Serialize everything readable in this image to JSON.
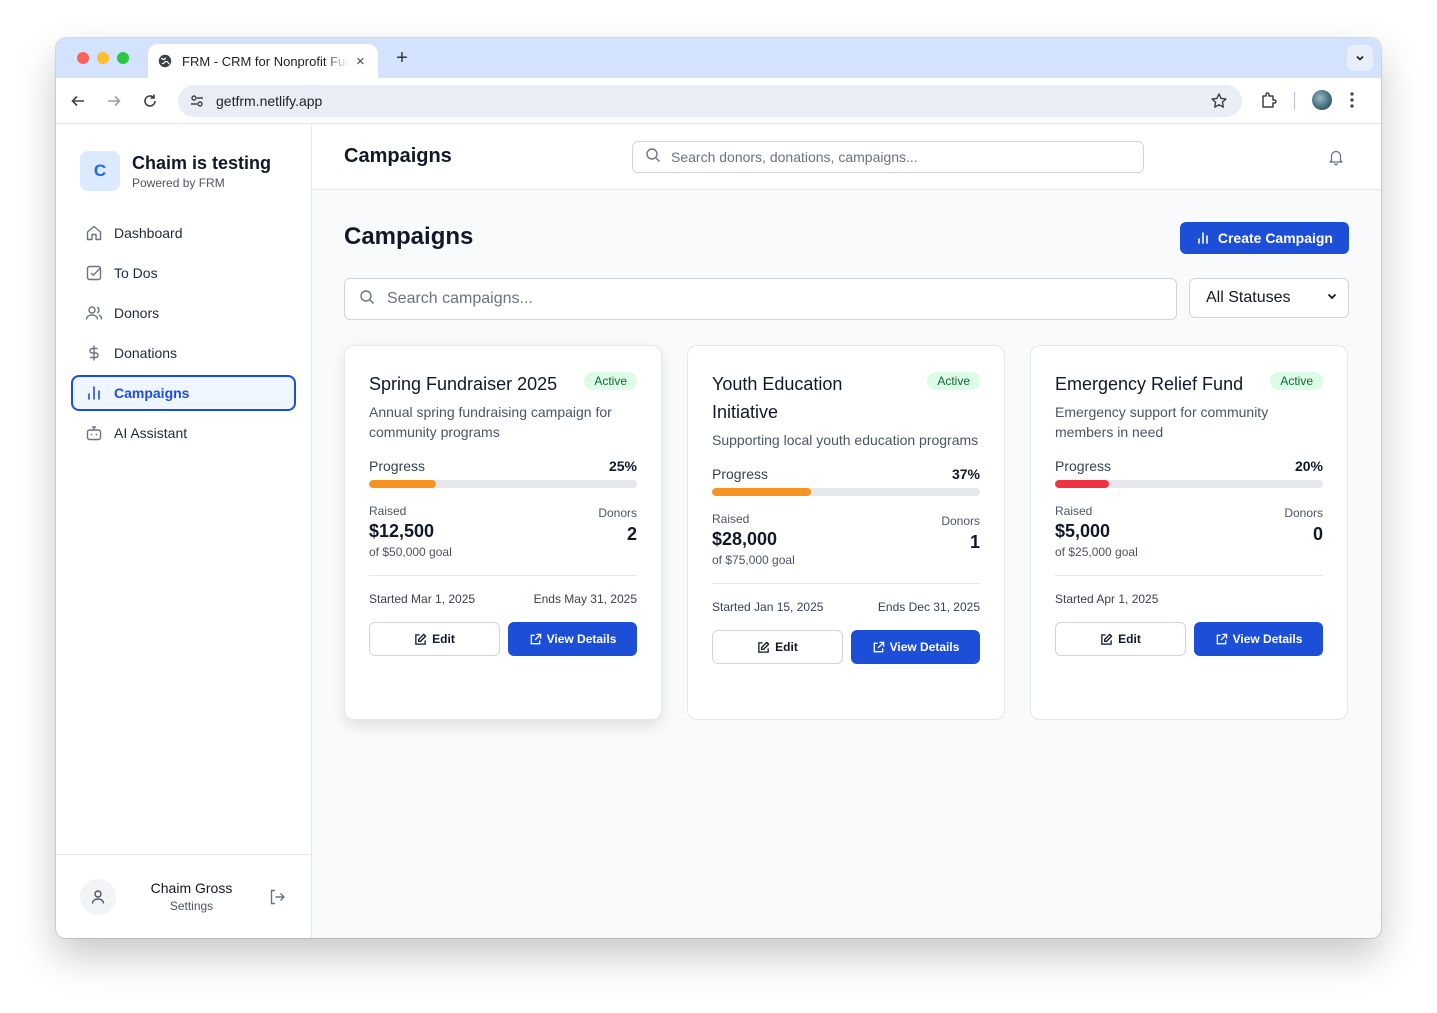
{
  "browser": {
    "tab_title": "FRM - CRM for Nonprofit Fundraising",
    "url": "getfrm.netlify.app"
  },
  "brand": {
    "logo_letter": "C",
    "name": "Chaim is testing",
    "subtitle": "Powered by FRM"
  },
  "sidebar": {
    "items": [
      {
        "label": "Dashboard",
        "icon": "home-icon"
      },
      {
        "label": "To Dos",
        "icon": "checkbox-icon"
      },
      {
        "label": "Donors",
        "icon": "users-icon"
      },
      {
        "label": "Donations",
        "icon": "dollar-icon"
      },
      {
        "label": "Campaigns",
        "icon": "bar-chart-icon",
        "active": true
      },
      {
        "label": "AI Assistant",
        "icon": "bot-icon"
      }
    ]
  },
  "user": {
    "name": "Chaim Gross",
    "settings_label": "Settings"
  },
  "header": {
    "title": "Campaigns",
    "search_placeholder": "Search donors, donations, campaigns..."
  },
  "page": {
    "title": "Campaigns",
    "create_label": "Create Campaign",
    "search_placeholder": "Search campaigns...",
    "status_filter": "All Statuses"
  },
  "labels": {
    "progress": "Progress",
    "raised": "Raised",
    "donors": "Donors",
    "edit": "Edit",
    "view_details": "View Details"
  },
  "campaigns": [
    {
      "title": "Spring Fundraiser 2025",
      "status": "Active",
      "description": "Annual spring fundraising campaign for community programs",
      "progress": 25,
      "progress_label": "25%",
      "progress_color": "#f7931e",
      "raised": "$12,500",
      "goal": "of $50,000 goal",
      "donors": "2",
      "started": "Started Mar 1, 2025",
      "ends": "Ends May 31, 2025"
    },
    {
      "title": "Youth Education Initiative",
      "status": "Active",
      "description": "Supporting local youth education programs",
      "progress": 37,
      "progress_label": "37%",
      "progress_color": "#f7931e",
      "raised": "$28,000",
      "goal": "of $75,000 goal",
      "donors": "1",
      "started": "Started Jan 15, 2025",
      "ends": "Ends Dec 31, 2025"
    },
    {
      "title": "Emergency Relief Fund",
      "status": "Active",
      "description": "Emergency support for community members in need",
      "progress": 20,
      "progress_label": "20%",
      "progress_color": "#ef3340",
      "raised": "$5,000",
      "goal": "of $25,000 goal",
      "donors": "0",
      "started": "Started Apr 1, 2025",
      "ends": ""
    }
  ],
  "colors": {
    "accent": "#1d4ed8",
    "badge_bg": "#dcfce7",
    "badge_text": "#166534"
  }
}
